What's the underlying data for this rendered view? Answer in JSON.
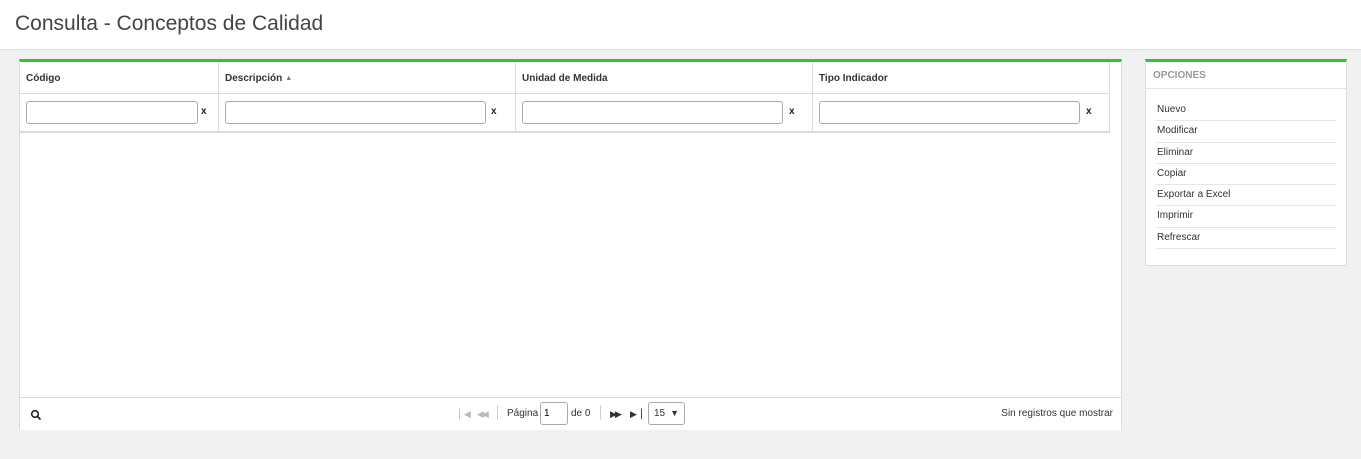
{
  "page": {
    "title": "Consulta - Conceptos de Calidad"
  },
  "colors": {
    "accent": "#2bc72b"
  },
  "grid": {
    "columns": [
      {
        "label": "Código",
        "filter_value": "",
        "clear_label": "x"
      },
      {
        "label": "Descripción",
        "filter_value": "",
        "clear_label": "x",
        "sort_icon": "sort-icon"
      },
      {
        "label": "Unidad de Medida",
        "filter_value": "",
        "clear_label": "x"
      },
      {
        "label": "Tipo Indicador",
        "filter_value": "",
        "clear_label": "x"
      }
    ],
    "rows": []
  },
  "pager": {
    "search_icon": "search-icon",
    "page_label": "Página",
    "current_page": "1",
    "of_label": "de 0",
    "page_size": "15",
    "status": "Sin registros que mostrar"
  },
  "options": {
    "title": "OPCIONES",
    "items": [
      "Nuevo",
      "Modificar",
      "Eliminar",
      "Copiar",
      "Exportar a Excel",
      "Imprimir",
      "Refrescar"
    ]
  }
}
